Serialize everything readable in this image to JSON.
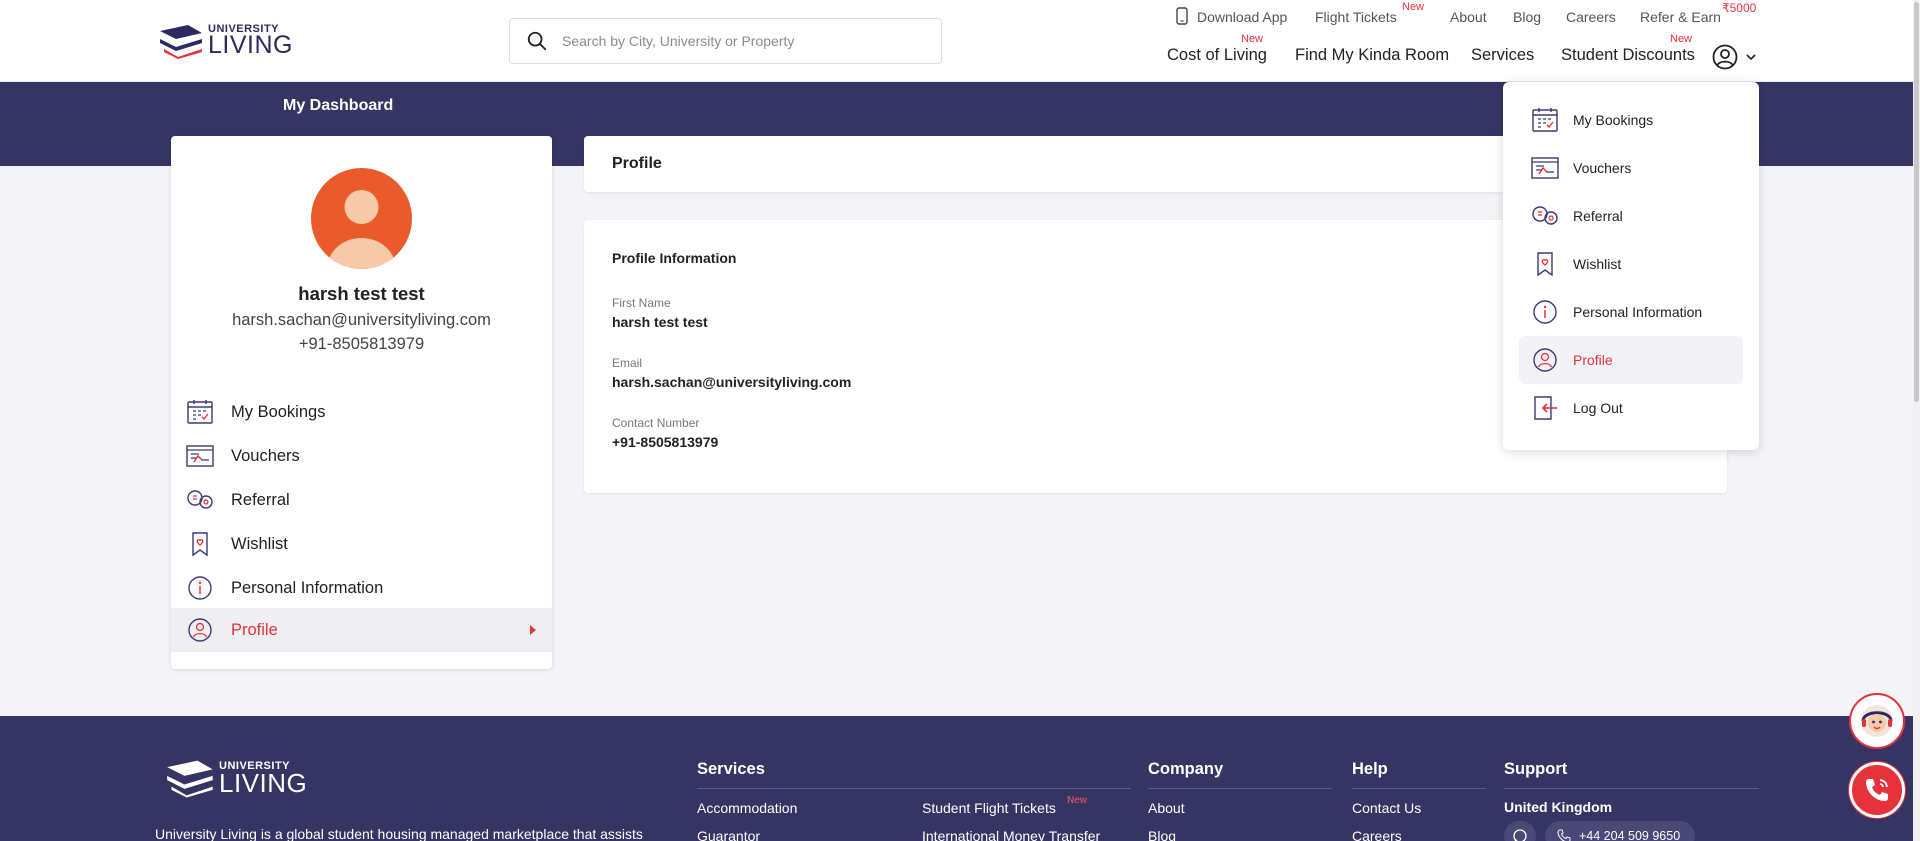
{
  "header": {
    "logo_small": "UNIVERSITY",
    "logo_large": "LIVING",
    "search_placeholder": "Search by City, University or Property",
    "top_links": {
      "download_app": "Download App",
      "flight_tickets": "Flight Tickets",
      "flight_badge": "New",
      "about": "About",
      "blog": "Blog",
      "careers": "Careers",
      "refer_earn": "Refer & Earn",
      "refer_badge": "₹5000"
    },
    "main_nav": {
      "cost_of_living": "Cost of Living",
      "cost_badge": "New",
      "find_room": "Find My Kinda Room",
      "services": "Services",
      "student_discounts": "Student Discounts",
      "discounts_badge": "New"
    }
  },
  "banner": {
    "title": "My Dashboard"
  },
  "user": {
    "name": "harsh test test",
    "email": "harsh.sachan@universityliving.com",
    "phone": "+91-8505813979"
  },
  "sidebar": {
    "items": [
      {
        "label": "My Bookings",
        "icon": "calendar-icon"
      },
      {
        "label": "Vouchers",
        "icon": "voucher-icon"
      },
      {
        "label": "Referral",
        "icon": "referral-icon"
      },
      {
        "label": "Wishlist",
        "icon": "bookmark-heart-icon"
      },
      {
        "label": "Personal Information",
        "icon": "info-icon"
      },
      {
        "label": "Profile",
        "icon": "user-circle-icon",
        "active": true
      }
    ]
  },
  "profile": {
    "header_title": "Profile",
    "section_title": "Profile Information",
    "fields": [
      {
        "label": "First Name",
        "value": "harsh test test"
      },
      {
        "label": "Email",
        "value": "harsh.sachan@universityliving.com"
      },
      {
        "label": "Contact Number",
        "value": "+91-8505813979"
      }
    ]
  },
  "dropdown": {
    "items": [
      {
        "label": "My Bookings",
        "icon": "calendar-icon"
      },
      {
        "label": "Vouchers",
        "icon": "voucher-icon"
      },
      {
        "label": "Referral",
        "icon": "referral-icon"
      },
      {
        "label": "Wishlist",
        "icon": "bookmark-heart-icon"
      },
      {
        "label": "Personal Information",
        "icon": "info-icon"
      },
      {
        "label": "Profile",
        "icon": "user-circle-icon",
        "active": true
      },
      {
        "label": "Log Out",
        "icon": "logout-icon"
      }
    ]
  },
  "footer": {
    "logo_small": "UNIVERSITY",
    "logo_large": "LIVING",
    "description": "University Living is a global student housing managed marketplace that assists",
    "services_heading": "Services",
    "services_links": [
      "Accommodation",
      "Guarantor"
    ],
    "services_links_2": [
      "Student Flight Tickets",
      "International Money Transfer"
    ],
    "services_new_badge": "New",
    "company_heading": "Company",
    "company_links": [
      "About",
      "Blog"
    ],
    "help_heading": "Help",
    "help_links": [
      "Contact Us",
      "Careers"
    ],
    "support_heading": "Support",
    "support_country": "United Kingdom",
    "support_phone": "+44 204 509 9650"
  },
  "colors": {
    "brand_navy": "#363463",
    "accent_red": "#e5323b",
    "avatar_orange": "#eb5a2b"
  }
}
